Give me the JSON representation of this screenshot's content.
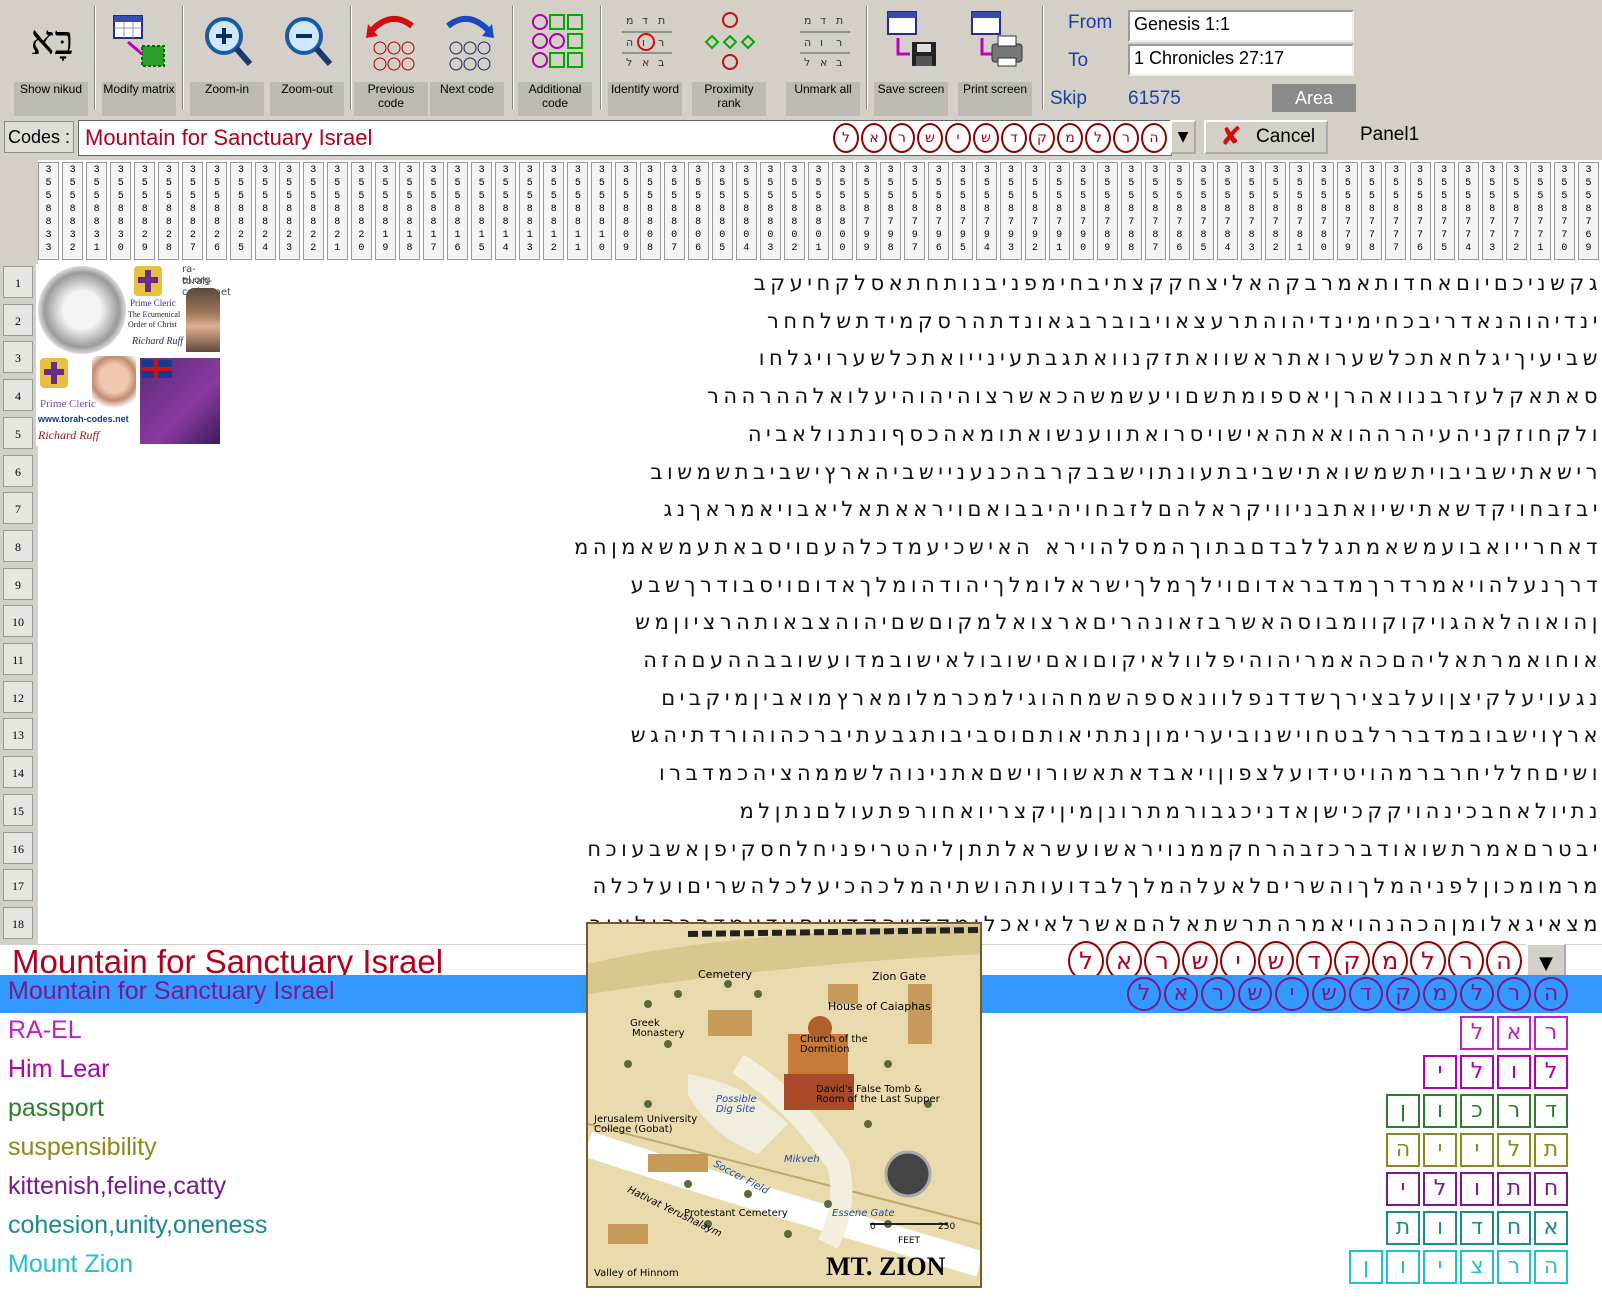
{
  "toolbar": {
    "buttons": [
      {
        "label": "Show nikud"
      },
      {
        "label": "Modify matrix"
      },
      {
        "label": "Zoom-in"
      },
      {
        "label": "Zoom-out"
      },
      {
        "label": "Previous code"
      },
      {
        "label": "Next code"
      },
      {
        "label": "Additional code"
      },
      {
        "label": "Identify word"
      },
      {
        "label": "Proximity rank"
      },
      {
        "label": "Unmark all"
      },
      {
        "label": "Save screen"
      },
      {
        "label": "Print screen"
      }
    ],
    "show_nikud_glyph": "בָּא",
    "from_label": "From",
    "from_value": "Genesis 1:1",
    "to_label": "To",
    "to_value": "1 Chronicles 27:17",
    "skip_label": "Skip",
    "skip_value": "61575",
    "area_label": "Area"
  },
  "codes": {
    "label": "Codes :",
    "value": "Mountain for Sanctuary Israel",
    "hebrew": "הרלמקדשישראל",
    "cancel_label": "Cancel",
    "panel_label": "Panel1"
  },
  "grid": {
    "column_headers": [
      "3558833",
      "3558832",
      "3558831",
      "3558830",
      "3558829",
      "3558828",
      "3558827",
      "3558826",
      "3558825",
      "3558824",
      "3558823",
      "3558822",
      "3558821",
      "3558820",
      "3558819",
      "3558818",
      "3558817",
      "3558816",
      "3558815",
      "3558814",
      "3558813",
      "3558812",
      "3558811",
      "3558810",
      "3558809",
      "3558808",
      "3558807",
      "3558806",
      "3558805",
      "3558804",
      "3558803",
      "3558802",
      "3558801",
      "3558800",
      "3558799",
      "3558798",
      "3558797",
      "3558796",
      "3558795",
      "3558794",
      "3558793",
      "3558792",
      "3558791",
      "3558790",
      "3558789",
      "3558788",
      "3558787",
      "3558786",
      "3558785",
      "3558784",
      "3558783",
      "3558782",
      "3558781",
      "3558780",
      "3558779",
      "3558778",
      "3558777",
      "3558776",
      "3558775",
      "3558774",
      "3558773",
      "3558772",
      "3558771",
      "3558770",
      "3558769"
    ],
    "rows": [
      {
        "n": "1",
        "text": "גקשניכםיוםאחדותאמרבקהאליצחקקצתיבחימפניבנותחתאסלקחיעקב"
      },
      {
        "n": "2",
        "text": "ינדיהוהנאדריבכחימינדיהוהתרעצאויבוברבגאונדתהרסקמידתשלחחר"
      },
      {
        "n": "3",
        "text": "שביעיךיגלחאתכלשערואתראשוואתזקנוואתגבתעינייואתכלשערויגלחו"
      },
      {
        "n": "4",
        "text": "סאתאקלעזרבנוואהרןיאספומתשםויעשמשהכאשרצוהיהוהיעלואלההרההר"
      },
      {
        "n": "5",
        "text": "ולקחוזקניהעיהרההואאתהאישויסרואתווענשואתומאהכסףונתנולאביה"
      },
      {
        "n": "6",
        "text": "רישאתישביבויתשמשואתישביבתעונתוישבבקרבהכנעניישביהארץישביבתשמשוב"
      },
      {
        "n": "7",
        "text": "יבזבחויקדשאתישיואתבניוויקראלהםלזבחויהיבבואםויראאתאליאבויאמראךנג"
      },
      {
        "n": "8",
        "text": "דאחרייואבועמשאמתגללבדםבתוךהמסלהוירא האישכיעמדכלהעםויסבאתעמשאמןהמ"
      },
      {
        "n": "9",
        "text": "דרךנעלהויאמרדרךמדבראדוםוילךמלךישראלומלךיהודהומלךאדוםויסבודרךשבע"
      },
      {
        "n": "10",
        "text": "ןהואוהלאהגויקוקוומבוסהאשרבזאונהריםארצואלמקוםשםיהוהצבאותהרציוןמש"
      },
      {
        "n": "11",
        "text": "אוחואמרתאליהםכהאמריהוהיפלוולאיקוםואםישובולאישובמדועשובבההעםהזה"
      },
      {
        "n": "12",
        "text": "נגעויעלקיצןועלבצירךשדדנפלוונאספהשמחהוגילמכרמלומארץמואביןמיקבים"
      },
      {
        "n": "13",
        "text": "ארץוישבובמדבררלבטחוישנוביערימוןנתתיאותםוסביבותגבעתיברכהוהורדתיהגש"
      },
      {
        "n": "14",
        "text": "ושיםחלליחרברמהויטידועלצפוןויאבדאתאשורוישםאתנינוהלשממהציהכמדברו"
      },
      {
        "n": "15",
        "text": "נתיולאחבכינהויקקכישןאדניכגבורמתרונןמיןיקצריואחורפתעולםנתןלמ"
      },
      {
        "n": "16",
        "text": "יבטרםאמרתשואודברכזבהרחקממנויראשועשראלתתןליהטריפניחלחסקיפןאשבעוכח"
      },
      {
        "n": "17",
        "text": "מרמומכוןלפניהמלךוהשריםלאעלהמלךלבדועותהושתיהמלכהכיעלכלהשריםועלכלה"
      },
      {
        "n": "18",
        "text": "מצאיגאלומןהכהנהויאמרהתרשתאלהםאשרלאיאכלומקדשהקדשיםעדעמדהכהןלאור"
      }
    ]
  },
  "badge": {
    "site1": "ra-el.org",
    "site2": "torah-codes.net",
    "order_line1": "Prime Cleric",
    "order_line2": "The Ecumenical",
    "order_line3": "Order of Christ",
    "signature1": "Richard Ruff",
    "prime_cleric": "Prime Cleric",
    "web": "www.torah-codes.net",
    "signature2": "Richard Ruff"
  },
  "bottom": {
    "title": "Mountain for Sanctuary Israel",
    "title_hebrew": "הרלמקדשישראל",
    "items": [
      {
        "label": "Mountain for Sanctuary Israel",
        "color": "#7a1a8a",
        "hebrew": "הרלמקדשישראל",
        "selected": true
      },
      {
        "label": "RA-EL",
        "color": "#c020c0",
        "hebrew": "ראל"
      },
      {
        "label": "Him Lear",
        "color": "#b000b0",
        "hebrew": "לולי"
      },
      {
        "label": "passport",
        "color": "#2e7d2e",
        "hebrew": "דרכון"
      },
      {
        "label": "suspensibility",
        "color": "#8a8a1a",
        "hebrew": "תלייה"
      },
      {
        "label": "kittenish,feline,catty",
        "color": "#7a1a8a",
        "hebrew": "חתולי"
      },
      {
        "label": "cohesion,unity,oneness",
        "color": "#1a8a8a",
        "hebrew": "אחדות"
      },
      {
        "label": "Mount Zion",
        "color": "#20c0d0",
        "hebrew": "הרציון"
      }
    ]
  },
  "map": {
    "title": "MT. ZION",
    "labels": {
      "cemetery": "Cemetery",
      "zion_gate": "Zion Gate",
      "house": "House of Caiaphas",
      "greek1": "Greek",
      "greek2": "Monastery",
      "church1": "Church of the",
      "church2": "Dormition",
      "davids1": "David's False Tomb &",
      "davids2": "Room of the Last Supper",
      "dig1": "Possible",
      "dig2": "Dig Site",
      "jer1": "Jerusalem University",
      "jer2": "College (Gobat)",
      "mikveh": "Mikveh",
      "soccer": "Soccer Field",
      "hativat": "Hativat Yerushalaym",
      "protestant": "Protestant Cemetery",
      "essene": "Essene Gate",
      "hinnom": "Valley of Hinnom",
      "scale0": "0",
      "scale250": "250",
      "feet": "FEET"
    }
  }
}
